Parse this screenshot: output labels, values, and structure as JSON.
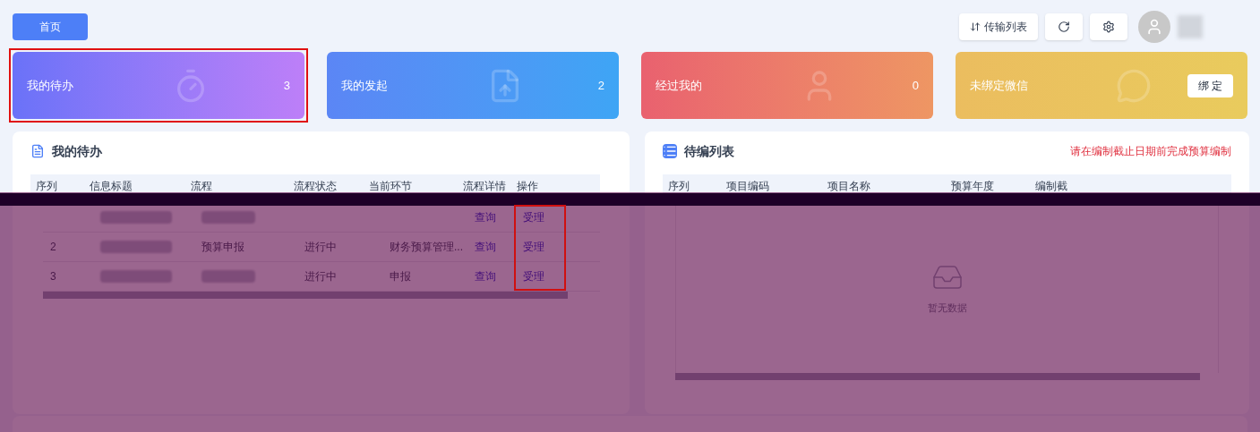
{
  "topbar": {
    "home_button": "首页",
    "transfer_button": "传输列表"
  },
  "stat_cards": [
    {
      "kind": "todo",
      "label": "我的待办",
      "count": "3",
      "highlighted": true
    },
    {
      "kind": "initiated",
      "label": "我的发起",
      "count": "2"
    },
    {
      "kind": "passed",
      "label": "经过我的",
      "count": "0"
    },
    {
      "kind": "wechat",
      "label": "未绑定微信",
      "action": "绑 定"
    }
  ],
  "todo_panel": {
    "title": "我的待办",
    "columns": [
      "序列",
      "信息标题",
      "流程",
      "流程状态",
      "当前环节",
      "流程详情",
      "操作"
    ],
    "rows": [
      {
        "detail": "查询",
        "action": "受理"
      },
      {
        "index": "2",
        "process": "预算申报",
        "status": "进行中",
        "step": "财务预算管理...",
        "detail": "查询",
        "action": "受理"
      },
      {
        "index": "3",
        "status": "进行中",
        "step": "申报",
        "detail": "查询",
        "action": "受理"
      }
    ],
    "action_column_highlighted": true
  },
  "draft_panel": {
    "title": "待编列表",
    "notice": "请在编制截止日期前完成预算编制",
    "columns": [
      "序列",
      "项目编码",
      "项目名称",
      "预算年度",
      "编制截"
    ],
    "empty_text": "暂无数据"
  }
}
